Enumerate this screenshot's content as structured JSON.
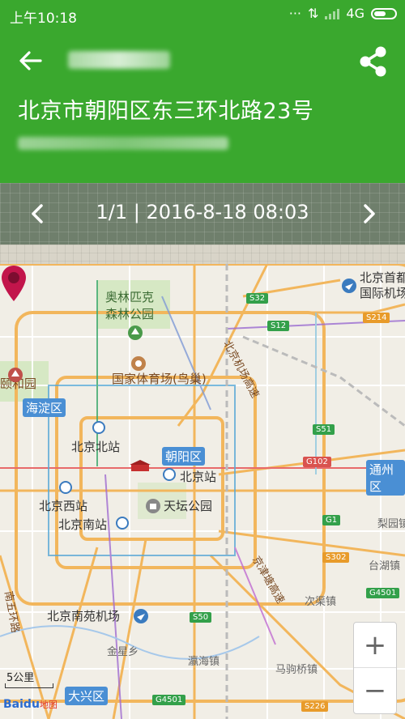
{
  "status_bar": {
    "time": "上午10:18",
    "network": "4G"
  },
  "header": {
    "address": "北京市朝阳区东三环北路23号"
  },
  "record_nav": {
    "label": "1/1 | 2016-8-18 08:03"
  },
  "map": {
    "labels": {
      "olympic_park": "奥林匹克森林公园",
      "national_stadium": "国家体育场(鸟巢)",
      "yiheyuan": "颐和园",
      "haidian": "海淀区",
      "beijing_north": "北京北站",
      "chaoyang": "朝阳区",
      "beijing_station": "北京站",
      "beijing_west": "北京西站",
      "tiantan": "天坛公园",
      "beijing_south": "北京南站",
      "nanyuan_airport": "北京南苑机场",
      "capital_airport": "北京首都国际机场",
      "tongzhou": "通州区",
      "liyuan": "梨园镇",
      "taihu": "台湖镇",
      "ciqu": "次渠镇",
      "jinxing": "金星乡",
      "yinghai": "瀛海镇",
      "majuqiao": "马驹桥镇",
      "daxing": "大兴区",
      "jingjin_expressway": "京津塘高速",
      "jingcheng": "北京机场高速",
      "south_5th_ring": "南五环路"
    },
    "shields": {
      "s32": "S32",
      "s12": "S12",
      "s214": "S214",
      "s51": "S51",
      "g102": "G102",
      "g1": "G1",
      "s302": "S302",
      "g4501": "G4501",
      "s50": "S50",
      "s226": "S226",
      "g4501_b": "G4501"
    },
    "scale": "5公里",
    "logo_bai": "Bai",
    "logo_du": "du",
    "logo_map": "地图",
    "zoom_in": "+",
    "zoom_out": "−"
  },
  "colors": {
    "header_green": "#3aa82e",
    "nav_gray": "#6f7f6c",
    "pin": "#c2154b"
  }
}
